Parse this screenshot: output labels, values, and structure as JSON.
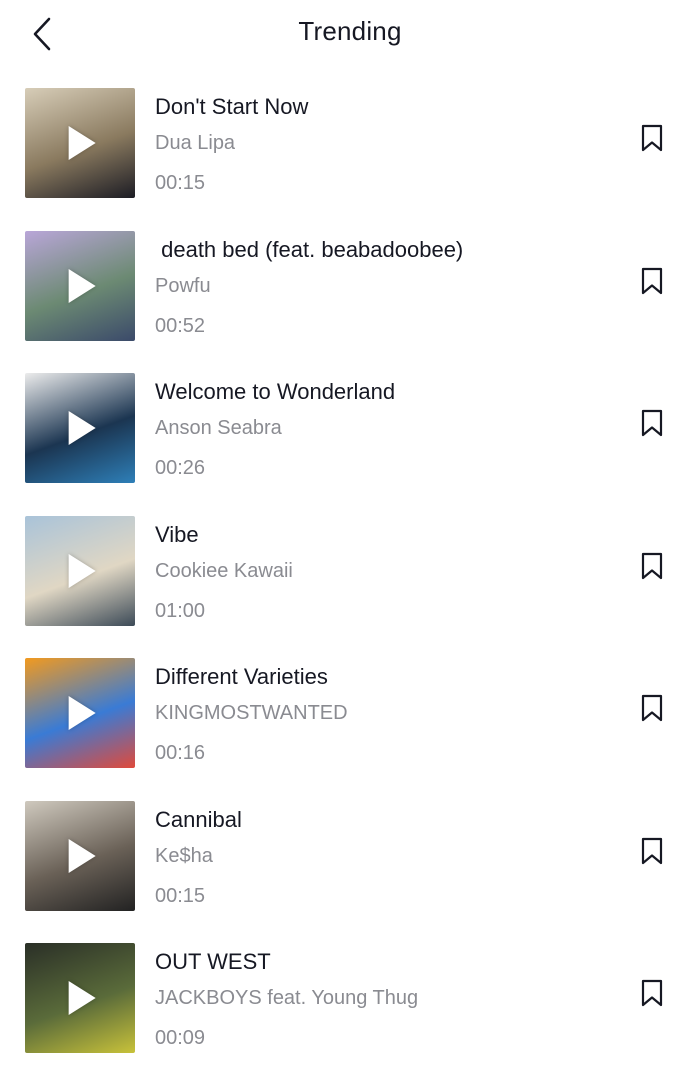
{
  "header": {
    "title": "Trending"
  },
  "songs": [
    {
      "title": "Don't Start Now",
      "artist": "Dua Lipa",
      "duration": "00:15",
      "cover_colors": [
        "#d7cdb8",
        "#1c1c24",
        "#8a7a5f"
      ]
    },
    {
      "title": " death bed (feat. beabadoobee)",
      "artist": "Powfu",
      "duration": "00:52",
      "cover_colors": [
        "#b9a6d8",
        "#3b4a6a",
        "#6c8a73"
      ]
    },
    {
      "title": "Welcome to Wonderland",
      "artist": "Anson Seabra",
      "duration": "00:26",
      "cover_colors": [
        "#ececec",
        "#2e7fb8",
        "#1b3551"
      ]
    },
    {
      "title": "Vibe",
      "artist": "Cookiee Kawaii",
      "duration": "01:00",
      "cover_colors": [
        "#a9c3d9",
        "#3c4a57",
        "#e0d7c4"
      ]
    },
    {
      "title": "Different Varieties",
      "artist": "KINGMOSTWANTED",
      "duration": "00:16",
      "cover_colors": [
        "#f29a1f",
        "#e04a3b",
        "#3a7bd5"
      ]
    },
    {
      "title": "Cannibal",
      "artist": "Ke$ha",
      "duration": "00:15",
      "cover_colors": [
        "#cfc9be",
        "#222222",
        "#6a6157"
      ]
    },
    {
      "title": "OUT WEST",
      "artist": "JACKBOYS feat. Young Thug",
      "duration": "00:09",
      "cover_colors": [
        "#2a2f27",
        "#c8c23a",
        "#5a6b3a"
      ]
    }
  ]
}
